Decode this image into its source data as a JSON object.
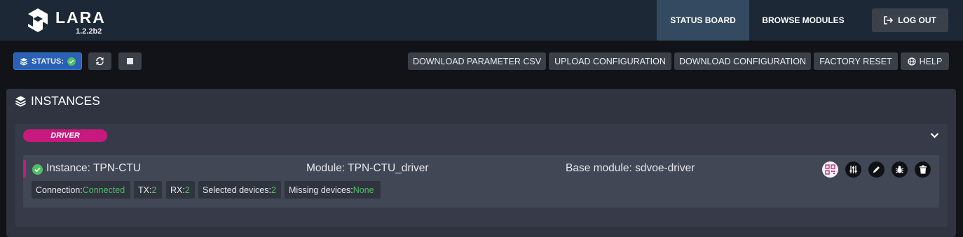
{
  "header": {
    "brand": "LARA",
    "version": "1.2.2b2",
    "tabs": [
      {
        "label": "STATUS BOARD",
        "active": true
      },
      {
        "label": "BROWSE MODULES",
        "active": false
      }
    ],
    "logout_label": "LOG OUT"
  },
  "toolbar": {
    "status_label": "STATUS:",
    "status_icon": "check-circle-icon",
    "refresh_icon": "refresh-icon",
    "stop_icon": "stop-icon",
    "actions": {
      "download_csv": "DOWNLOAD PARAMETER CSV",
      "upload_config": "UPLOAD CONFIGURATION",
      "download_config": "DOWNLOAD CONFIGURATION",
      "factory_reset": "FACTORY RESET",
      "help": "HELP"
    }
  },
  "instances": {
    "title": "INSTANCES",
    "group_label": "DRIVER",
    "item": {
      "instance": "Instance: TPN-CTU",
      "module": "Module: TPN-CTU_driver",
      "base_module": "Base module: sdvoe-driver",
      "stats": {
        "connection_label": "Connection: ",
        "connection_value": "Connected",
        "tx_label": "TX: ",
        "tx_value": "2",
        "rx_label": "RX: ",
        "rx_value": "2",
        "selected_label": "Selected devices: ",
        "selected_value": "2",
        "missing_label": "Missing devices: ",
        "missing_value": "None"
      },
      "actions": [
        "qr-code-icon",
        "sliders-icon",
        "pencil-icon",
        "bug-icon",
        "trash-icon"
      ]
    }
  },
  "colors": {
    "accent_magenta": "#c8197e",
    "status_blue": "#2a61b4",
    "success_green": "#4cc061",
    "topbar": "#1d2836"
  }
}
